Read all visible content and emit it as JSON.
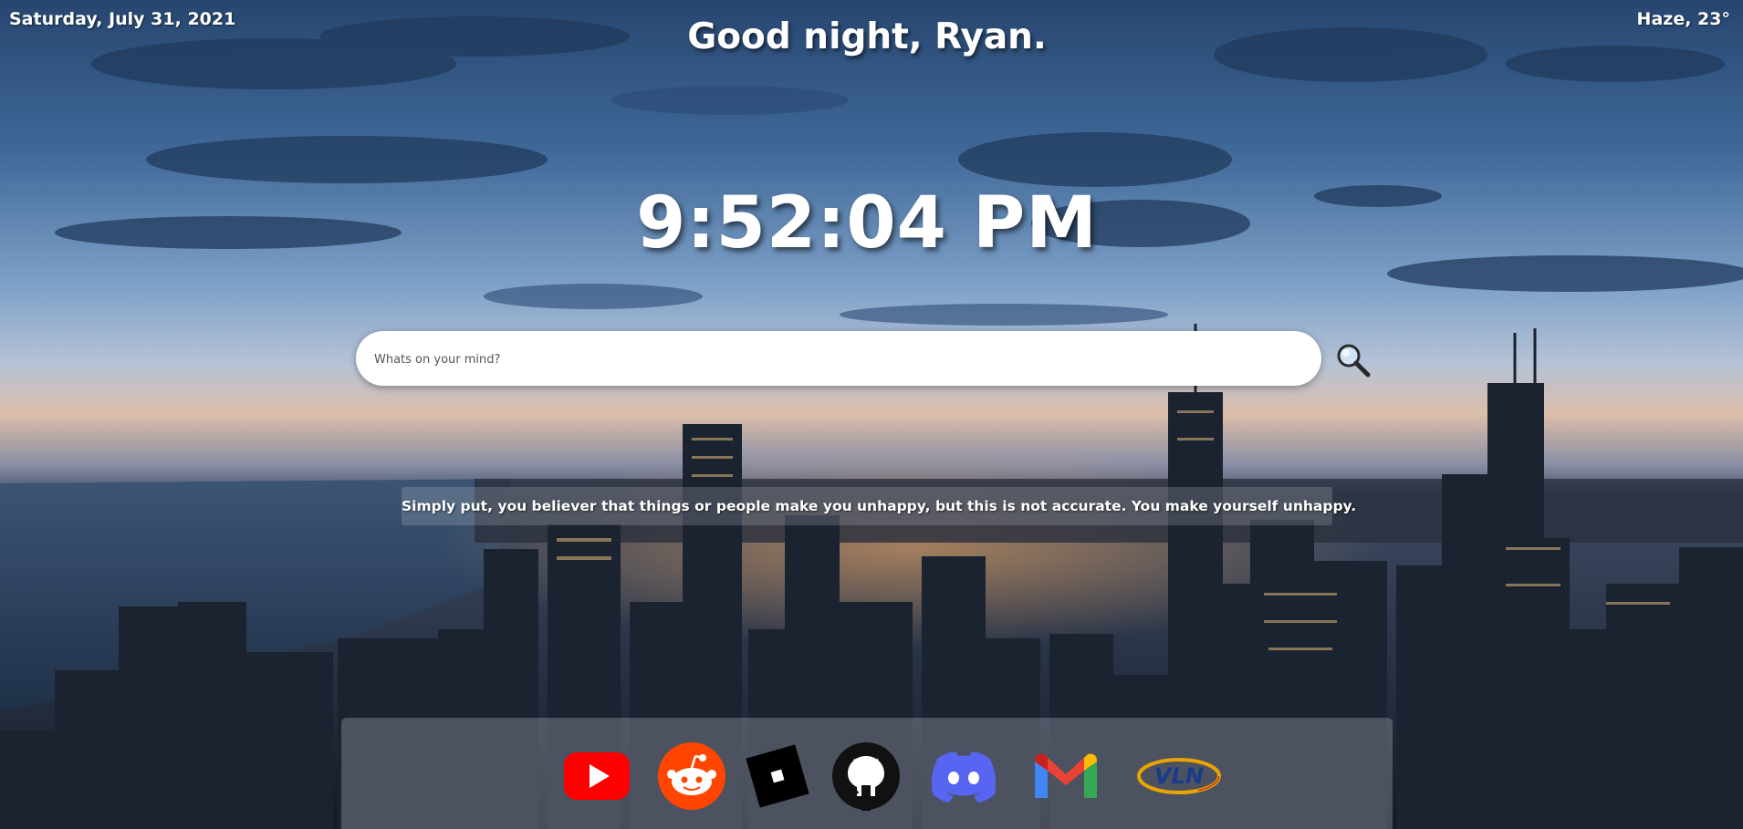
{
  "header": {
    "date": "Saturday, July 31, 2021",
    "greeting": "Good night, Ryan.",
    "weather": "Haze, 23°"
  },
  "clock": {
    "time": "9:52:04 PM"
  },
  "search": {
    "placeholder": "Whats on your mind?",
    "value": ""
  },
  "quote": {
    "text": "Simply put, you believer that things or people make you unhappy, but this is not accurate. You make yourself unhappy."
  },
  "shortcuts": [
    {
      "icon": "youtube-icon",
      "color": "#ff0000"
    },
    {
      "icon": "reddit-icon",
      "color": "#ff4500"
    },
    {
      "icon": "roblox-icon",
      "color": "#000000"
    },
    {
      "icon": "github-icon",
      "color": "#111111"
    },
    {
      "icon": "discord-icon",
      "color": "#5865f2"
    },
    {
      "icon": "gmail-icon",
      "color": "#ea4335"
    },
    {
      "icon": "vln-logo-icon",
      "text": "VLN",
      "color": "#1a3a8a"
    }
  ],
  "colors": {
    "text": "#ffffff",
    "search_bg": "#ffffff",
    "sky_top": "#2c4f7d",
    "horizon": "#e8b89a"
  }
}
